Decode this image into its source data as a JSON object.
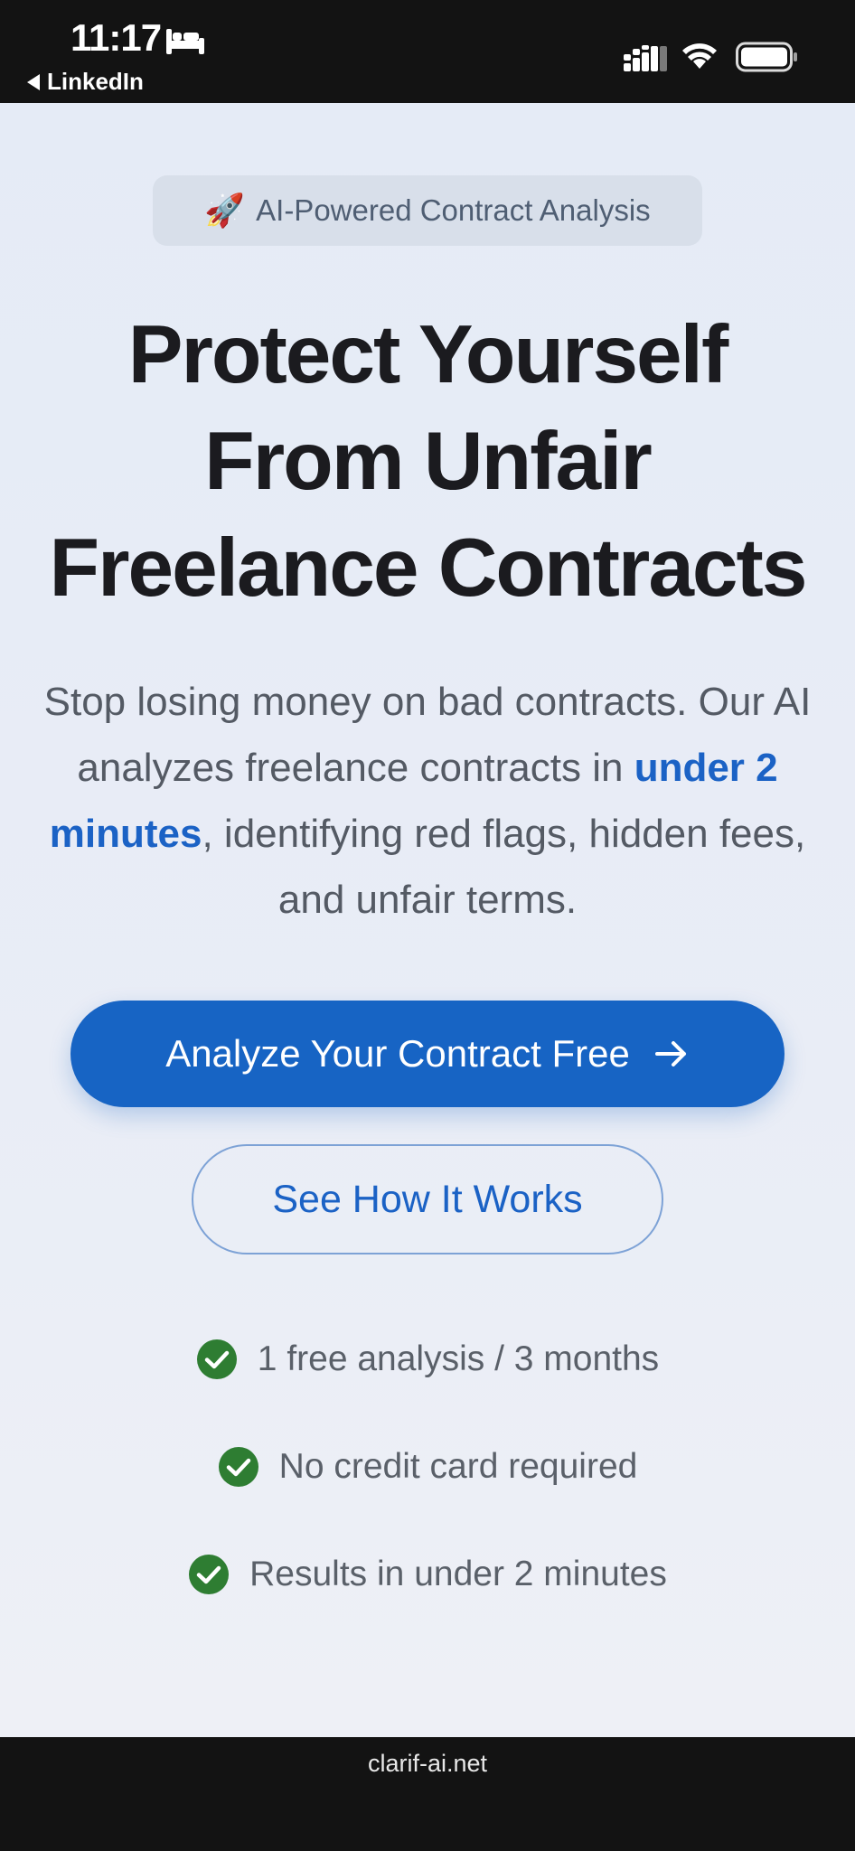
{
  "status_bar": {
    "time": "11:17",
    "back_label": "LinkedIn",
    "icons": [
      "bed-icon",
      "signal-icon",
      "wifi-icon",
      "battery-icon"
    ]
  },
  "hero": {
    "badge_emoji": "🚀",
    "badge_text": "AI-Powered Contract Analysis",
    "title_lines": [
      "Protect Yourself",
      "From Unfair",
      "Freelance Contracts"
    ],
    "subtitle_before": "Stop losing money on bad contracts. Our AI analyzes freelance contracts in ",
    "subtitle_highlight": "under 2 minutes",
    "subtitle_after": ", identifying red flags, hidden fees, and unfair terms."
  },
  "buttons": {
    "primary_label": "Analyze Your Contract Free",
    "secondary_label": "See How It Works"
  },
  "features": [
    "1 free analysis / 3 months",
    "No credit card required",
    "Results in under 2 minutes"
  ],
  "browser": {
    "url": "clarif-ai.net"
  },
  "colors": {
    "accent": "#1764c4",
    "check": "#2e7d32",
    "background": "#e5ebf6"
  }
}
